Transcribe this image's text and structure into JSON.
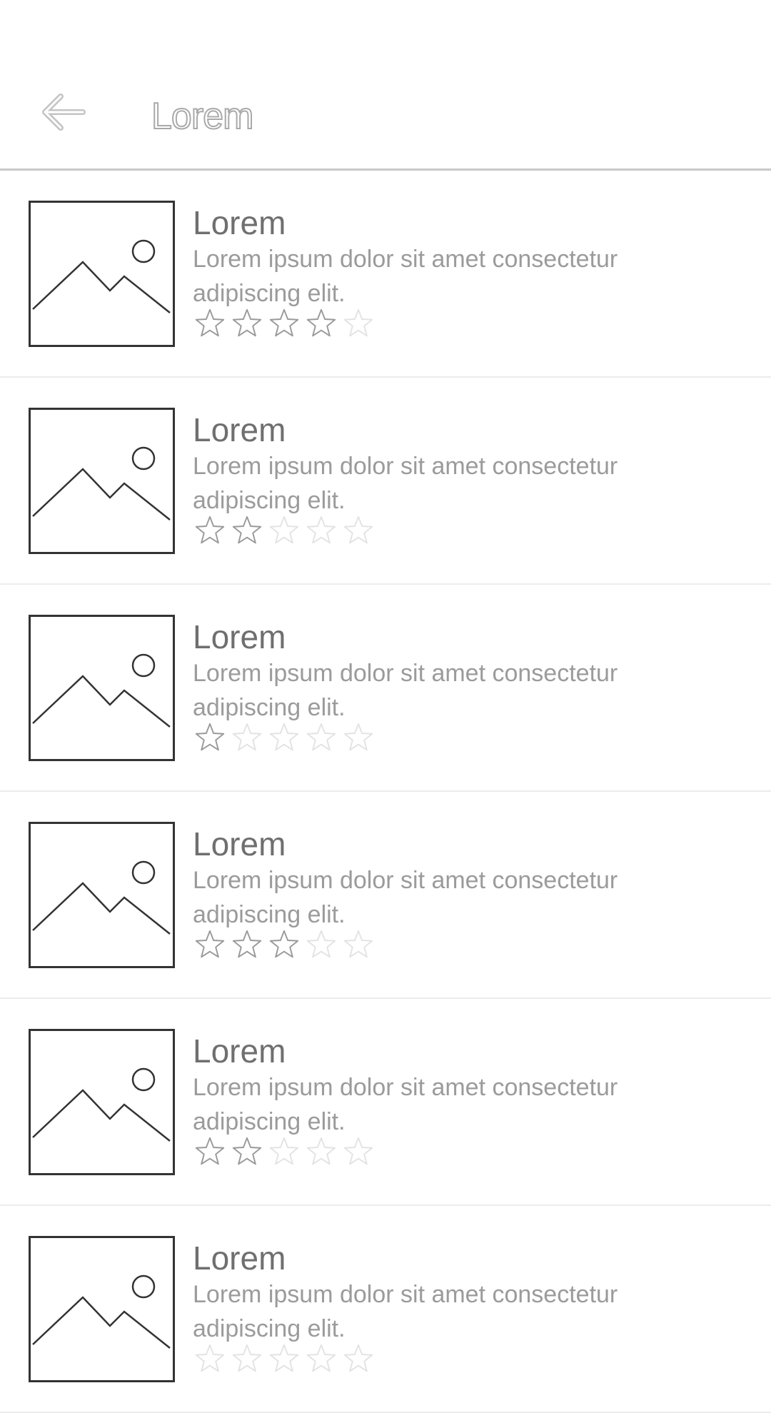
{
  "header": {
    "title": "Lorem",
    "back_icon": "arrow-left-icon"
  },
  "items": [
    {
      "title": "Lorem",
      "description": "Lorem ipsum dolor sit amet consectetur adipiscing elit.",
      "image_icon": "image-placeholder-icon",
      "rating": 4,
      "max_rating": 5
    },
    {
      "title": "Lorem",
      "description": "Lorem ipsum dolor sit amet consectetur adipiscing elit.",
      "image_icon": "image-placeholder-icon",
      "rating": 2,
      "max_rating": 5
    },
    {
      "title": "Lorem",
      "description": "Lorem ipsum dolor sit amet consectetur adipiscing elit.",
      "image_icon": "image-placeholder-icon",
      "rating": 1,
      "max_rating": 5
    },
    {
      "title": "Lorem",
      "description": "Lorem ipsum dolor sit amet consectetur adipiscing elit.",
      "image_icon": "image-placeholder-icon",
      "rating": 3,
      "max_rating": 5
    },
    {
      "title": "Lorem",
      "description": "Lorem ipsum dolor sit amet consectetur adipiscing elit.",
      "image_icon": "image-placeholder-icon",
      "rating": 2,
      "max_rating": 5
    },
    {
      "title": "Lorem",
      "description": "Lorem ipsum dolor sit amet consectetur adipiscing elit.",
      "image_icon": "image-placeholder-icon",
      "rating": 0,
      "max_rating": 5
    }
  ],
  "colors": {
    "star_filled": "#9a9a9a",
    "star_empty": "#e3e3e3",
    "divider": "#ececec",
    "title_text": "#6f6f6f",
    "description_text": "#9b9b9b"
  }
}
